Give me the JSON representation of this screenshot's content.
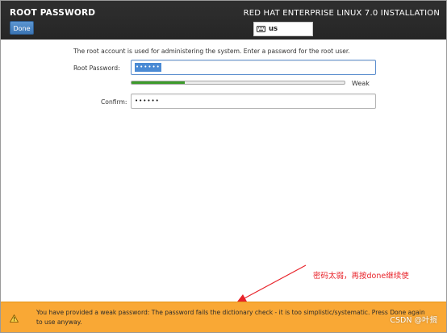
{
  "header": {
    "title": "ROOT PASSWORD",
    "done_label": "Done",
    "product": "RED HAT ENTERPRISE LINUX 7.0 INSTALLATION",
    "keyboard_layout": "us"
  },
  "form": {
    "info": "The root account is used for administering the system.  Enter a password for the root user.",
    "password_label": "Root Password:",
    "password_value": "••••••",
    "confirm_label": "Confirm:",
    "confirm_value": "••••••",
    "strength_fraction": 0.25,
    "strength_label": "Weak",
    "strength_color": "#3d9b2c"
  },
  "annotation": {
    "text": "密码太弱，再按done继续使",
    "color": "#e8232a"
  },
  "warning": {
    "text": "You have provided a weak password: The password fails the dictionary check - it is too simplistic/systematic.  Press Done again to use anyway.",
    "bar_color": "#f9a835"
  },
  "watermark": "CSDN @叶搁"
}
